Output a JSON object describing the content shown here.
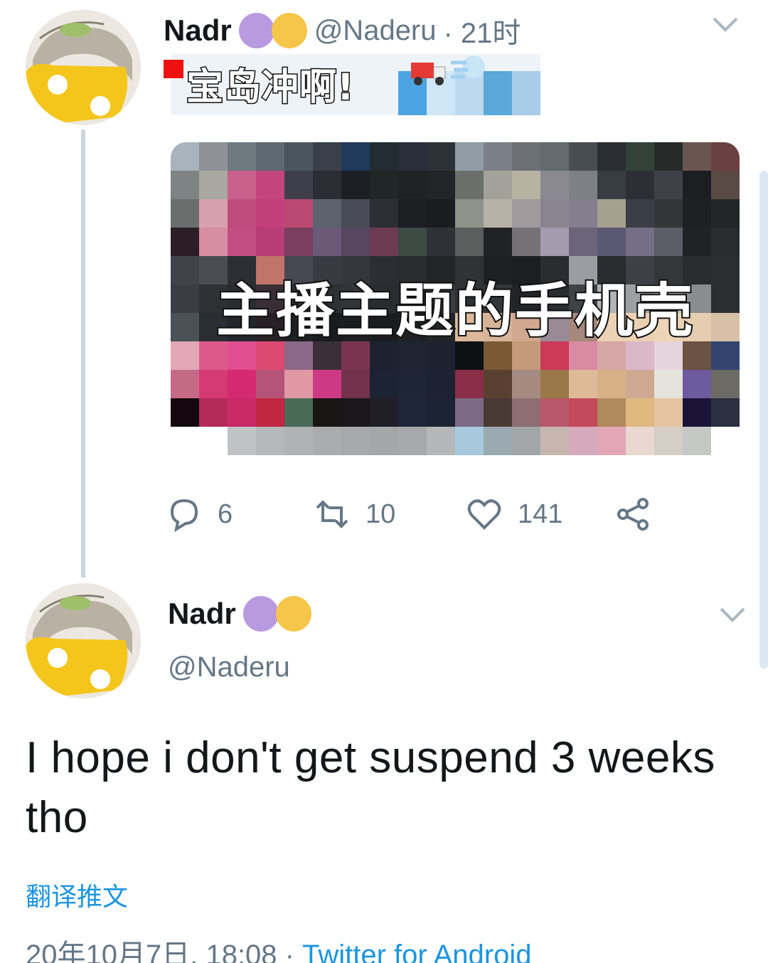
{
  "tweet1": {
    "author_name": "Nadr",
    "handle": "@Naderu",
    "time": "· 21时",
    "sticker_caption": "宝岛冲啊!",
    "media_caption": "主播主题的手机壳",
    "actions": {
      "replies": "6",
      "retweets": "10",
      "likes": "141"
    }
  },
  "tweet2": {
    "author_name": "Nadr",
    "handle": "@Naderu",
    "text_line1": "I hope i don't get suspend 3 weeks",
    "text_line2": "tho",
    "translate_label": "翻译推文",
    "date": "20年10月7日, 18:08 ·",
    "source": "Twitter for Android"
  },
  "colors": {
    "badge_purple": "#b89ae0",
    "badge_yellow": "#f6c64a",
    "link_blue": "#1b95e0",
    "secondary_text": "#657786"
  },
  "icons": [
    "chevron-down-icon",
    "reply-icon",
    "retweet-icon",
    "like-icon",
    "share-icon",
    "truck-emoji-icon",
    "dash-emoji-icon"
  ]
}
